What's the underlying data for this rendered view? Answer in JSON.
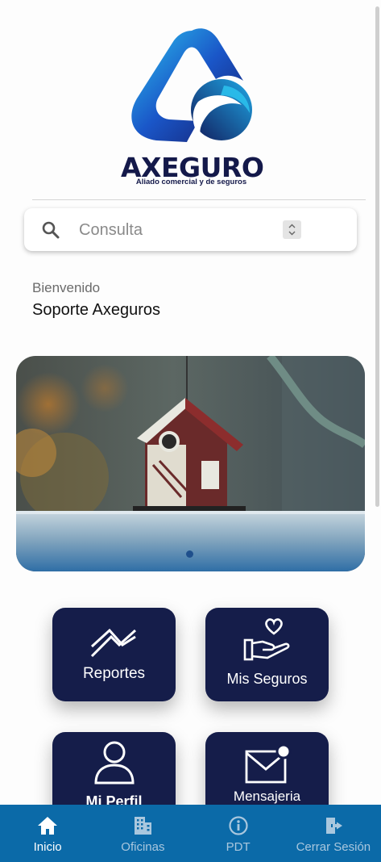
{
  "brand": {
    "name": "AXEGURO",
    "tagline": "Aliado comercial y de seguros",
    "colors": {
      "navy": "#14194a",
      "blue": "#1a56c8",
      "cyan": "#2bb6e8"
    }
  },
  "search": {
    "placeholder": "Consulta",
    "value": ""
  },
  "welcome": {
    "greeting": "Bienvenido",
    "user": "Soporte Axeguros"
  },
  "banner": {
    "image": "birdhouse-photo",
    "slides": 1,
    "active_slide": 1
  },
  "tiles": [
    {
      "label": "Reportes",
      "icon": "chart-trend-icon"
    },
    {
      "label": "Mis Seguros",
      "icon": "hand-heart-icon"
    },
    {
      "label": "Mi Perfil",
      "icon": "user-icon"
    },
    {
      "label": "Mensajeria",
      "icon": "mail-notification-icon"
    }
  ],
  "bottom_nav": {
    "background": "#0b6aa8",
    "items": [
      {
        "label": "Inicio",
        "icon": "home-icon",
        "active": true
      },
      {
        "label": "Oficinas",
        "icon": "building-icon",
        "active": false
      },
      {
        "label": "PDT",
        "icon": "info-icon",
        "active": false
      },
      {
        "label": "Cerrar Sesión",
        "icon": "logout-icon",
        "active": false
      }
    ]
  }
}
